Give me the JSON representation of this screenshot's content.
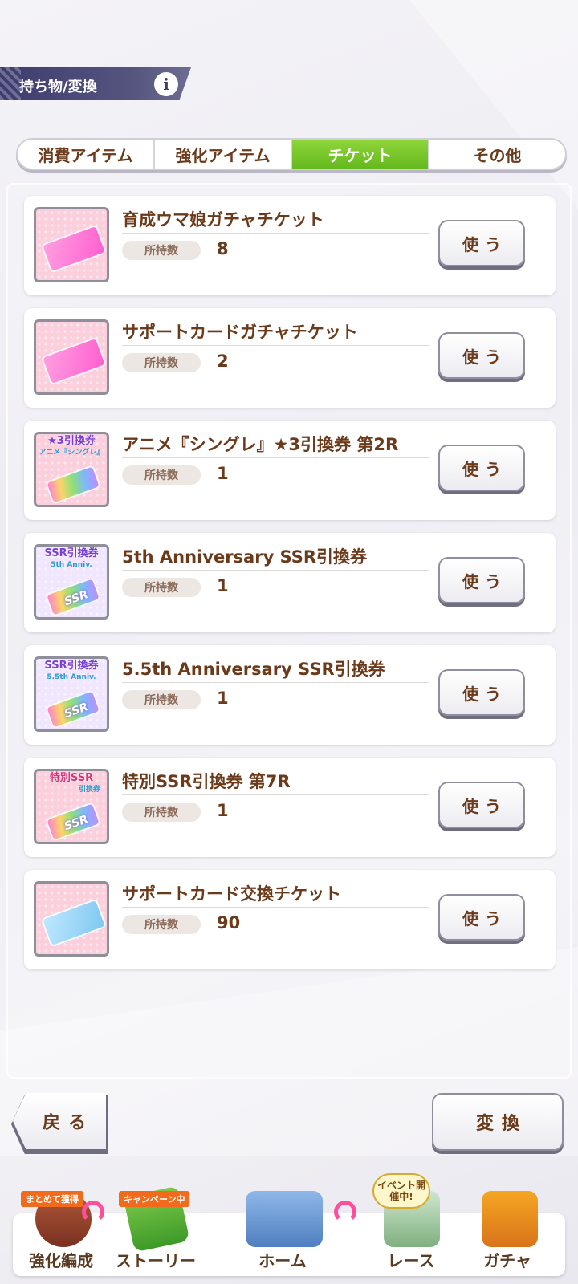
{
  "header": {
    "title": "持ち物/変換",
    "info_icon": "i"
  },
  "tabs": [
    {
      "label": "消費アイテム",
      "active": false
    },
    {
      "label": "強化アイテム",
      "active": false
    },
    {
      "label": "チケット",
      "active": true
    },
    {
      "label": "その他",
      "active": false
    }
  ],
  "own_label": "所持数",
  "use_label": "使う",
  "items": [
    {
      "name": "育成ウマ娘ガチャチケット",
      "count": "8",
      "icon": "pink-ticket-icon"
    },
    {
      "name": "サポートカードガチャチケット",
      "count": "2",
      "icon": "pink-ticket-icon"
    },
    {
      "name": "アニメ『シングレ』★3引換券 第2R",
      "count": "1",
      "icon": "anime-exchange-ticket-icon",
      "thumb_text": "★3引換券",
      "thumb_sub": "アニメ『シングレ』"
    },
    {
      "name": "5th Anniversary SSR引換券",
      "count": "1",
      "icon": "ssr-exchange-ticket-icon",
      "thumb_text": "SSR引換券",
      "thumb_sub": "5th Anniv.",
      "ticket_text": "SSR"
    },
    {
      "name": "5.5th Anniversary SSR引換券",
      "count": "1",
      "icon": "ssr-exchange-ticket-icon",
      "thumb_text": "SSR引換券",
      "thumb_sub": "5.5th Anniv.",
      "ticket_text": "SSR"
    },
    {
      "name": "特別SSR引換券 第7R",
      "count": "1",
      "icon": "special-ssr-ticket-icon",
      "thumb_text": "特別SSR",
      "thumb_sub": "引換券",
      "ticket_text": "SSR"
    },
    {
      "name": "サポートカード交換チケット",
      "count": "90",
      "icon": "blue-ticket-icon"
    }
  ],
  "footer": {
    "back_label": "戻る",
    "convert_label": "変換"
  },
  "nav": [
    {
      "label": "強化編成",
      "badge": "まとめて獲得"
    },
    {
      "label": "ストーリー",
      "badge": "キャンペーン中"
    },
    {
      "label": "ホーム",
      "badge": ""
    },
    {
      "label": "レース",
      "badge": "イベント開催中!"
    },
    {
      "label": "ガチャ",
      "badge": ""
    }
  ],
  "colors": {
    "accent_green": "#64b81d",
    "text_brown": "#6b3a1a",
    "header_navy": "#3d3c6e"
  }
}
